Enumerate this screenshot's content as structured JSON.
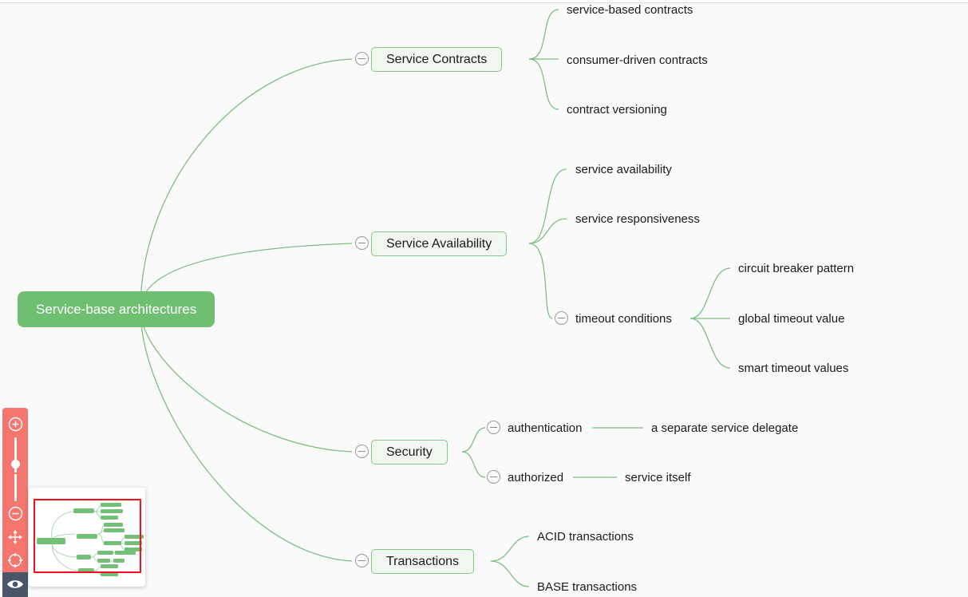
{
  "app": {
    "background_color": "#fafafa",
    "accent_green": "#6fbf73",
    "node_fill": "#f0f7ee",
    "node_border": "#86c68a",
    "edge_color": "#7cbf80",
    "toolbar_color": "#f4766e",
    "viewport_color": "#fc0d1b"
  },
  "mindmap": {
    "root": {
      "label": "Service-base architectures",
      "collapsed": false
    },
    "branches": [
      {
        "label": "Service Contracts",
        "toggle_state": "expanded",
        "children": [
          {
            "label": "service-based contracts"
          },
          {
            "label": "consumer-driven contracts"
          },
          {
            "label": "contract versioning"
          }
        ]
      },
      {
        "label": "Service Availability",
        "toggle_state": "expanded",
        "children": [
          {
            "label": "service availability"
          },
          {
            "label": "service responsiveness"
          },
          {
            "label": "timeout conditions",
            "toggle_state": "expanded",
            "children": [
              {
                "label": "circuit breaker pattern"
              },
              {
                "label": "global timeout value"
              },
              {
                "label": "smart timeout values"
              }
            ]
          }
        ]
      },
      {
        "label": "Security",
        "toggle_state": "expanded",
        "children": [
          {
            "label": "authentication",
            "toggle_state": "expanded",
            "children": [
              {
                "label": "a separate service delegate"
              }
            ]
          },
          {
            "label": "authorized",
            "toggle_state": "expanded",
            "children": [
              {
                "label": "service itself"
              }
            ]
          }
        ]
      },
      {
        "label": "Transactions",
        "toggle_state": "expanded",
        "children": [
          {
            "label": "ACID transactions"
          },
          {
            "label": "BASE transactions"
          }
        ]
      }
    ]
  },
  "toolbar": {
    "zoom_in": "zoom-in-icon",
    "zoom_slider": "zoom-slider",
    "zoom_out": "zoom-out-icon",
    "pan": "move-arrows-icon",
    "center": "crosshair-target-icon",
    "visibility": "eye-icon",
    "visibility_active": true
  },
  "minimap": {
    "name": "minimap-overview"
  }
}
